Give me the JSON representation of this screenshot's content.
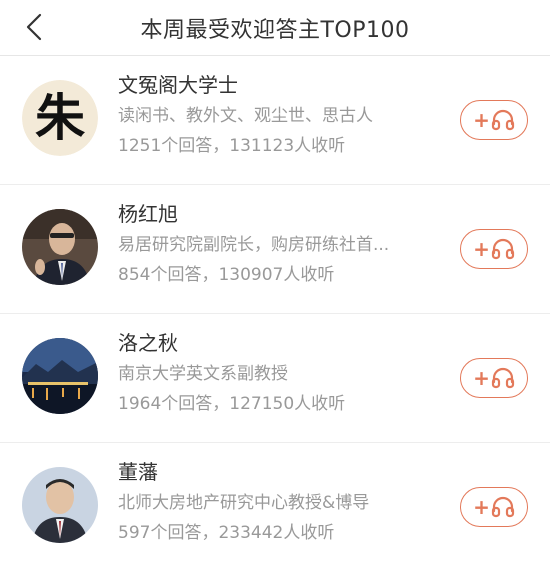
{
  "header": {
    "title": "本周最受欢迎答主TOP100"
  },
  "answerers": [
    {
      "name": "文冤阁大学士",
      "description": "读闲书、教外文、观尘世、思古人",
      "stats": "1251个回答，131123人收听",
      "avatar_glyph": "朱"
    },
    {
      "name": "杨红旭",
      "description": "易居研究院副院长，购房研练社首...",
      "stats": "854个回答，130907人收听"
    },
    {
      "name": "洛之秋",
      "description": "南京大学英文系副教授",
      "stats": "1964个回答，127150人收听"
    },
    {
      "name": "董藩",
      "description": "北师大房地产研究中心教授&博导",
      "stats": "597个回答，233442人收听"
    }
  ],
  "follow_button": {
    "plus": "+",
    "icon": "headphones-icon"
  },
  "colors": {
    "accent": "#e3795a",
    "muted_text": "#999999",
    "primary_text": "#333333"
  }
}
